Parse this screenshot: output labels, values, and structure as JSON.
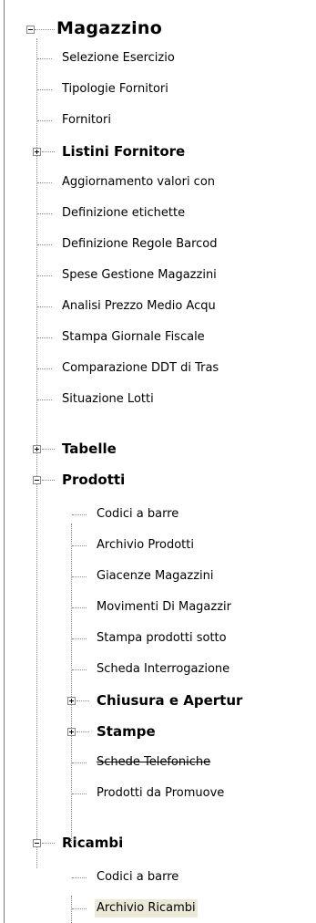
{
  "tree": {
    "root": {
      "label": "Magazzino"
    },
    "items_level1": [
      {
        "label": "Selezione Esercizio"
      },
      {
        "label": "Tipologie Fornitori"
      },
      {
        "label": "Fornitori"
      },
      {
        "label": "Listini Fornitore"
      },
      {
        "label": "Aggiornamento valori con"
      },
      {
        "label": "Definizione etichette"
      },
      {
        "label": "Definizione Regole Barcod"
      },
      {
        "label": "Spese Gestione Magazzini"
      },
      {
        "label": "Analisi Prezzo Medio Acqu"
      },
      {
        "label": "Stampa Giornale Fiscale"
      },
      {
        "label": "Comparazione DDT di Tras"
      },
      {
        "label": "Situazione Lotti"
      },
      {
        "label": "Tabelle"
      },
      {
        "label": "Prodotti"
      },
      {
        "label": "Ricambi"
      }
    ],
    "prodotti_children": [
      {
        "label": "Codici a barre"
      },
      {
        "label": "Archivio Prodotti"
      },
      {
        "label": "Giacenze Magazzini"
      },
      {
        "label": "Movimenti Di Magazzir"
      },
      {
        "label": "Stampa prodotti sotto"
      },
      {
        "label": "Scheda Interrogazione"
      },
      {
        "label": "Chiusura e Apertur"
      },
      {
        "label": "Stampe"
      },
      {
        "label": "Schede Telefoniche"
      },
      {
        "label": "Prodotti da Promuove"
      }
    ],
    "ricambi_children": [
      {
        "label": "Codici a barre"
      },
      {
        "label": "Archivio Ricambi"
      }
    ]
  }
}
